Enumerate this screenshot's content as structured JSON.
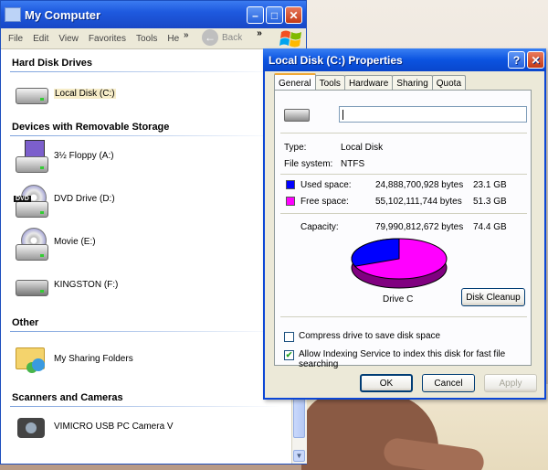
{
  "my_computer": {
    "title": "My Computer",
    "menu": [
      "File",
      "Edit",
      "View",
      "Favorites",
      "Tools",
      "He"
    ],
    "menu_more": "»",
    "back_label": "Back",
    "toolbar_more": "»",
    "groups": [
      {
        "heading": "Hard Disk Drives",
        "items": [
          {
            "label": "Local Disk (C:)",
            "icon": "hard-drive-icon"
          }
        ]
      },
      {
        "heading": "Devices with Removable Storage",
        "items": [
          {
            "label": "3½ Floppy (A:)",
            "icon": "floppy-drive-icon"
          },
          {
            "label": "DVD Drive (D:)",
            "icon": "dvd-drive-icon",
            "tag": "DVD"
          },
          {
            "label": "Movie (E:)",
            "icon": "cd-drive-icon"
          },
          {
            "label": "KINGSTON (F:)",
            "icon": "removable-drive-icon"
          }
        ]
      },
      {
        "heading": "Other",
        "items": [
          {
            "label": "My Sharing Folders",
            "icon": "shared-folder-icon"
          }
        ]
      },
      {
        "heading": "Scanners and Cameras",
        "items": [
          {
            "label": "VIMICRO USB PC Camera V",
            "icon": "camera-icon"
          }
        ]
      }
    ]
  },
  "dialog": {
    "title": "Local Disk (C:) Properties",
    "help": "?",
    "close": "✕",
    "tabs": [
      "General",
      "Tools",
      "Hardware",
      "Sharing",
      "Quota"
    ],
    "name_value": "",
    "type_label": "Type:",
    "type_value": "Local Disk",
    "fs_label": "File system:",
    "fs_value": "NTFS",
    "used_label": "Used space:",
    "used_bytes": "24,888,700,928 bytes",
    "used_gb": "23.1 GB",
    "free_label": "Free space:",
    "free_bytes": "55,102,111,744 bytes",
    "free_gb": "51.3 GB",
    "cap_label": "Capacity:",
    "cap_bytes": "79,990,812,672 bytes",
    "cap_gb": "74.4 GB",
    "drive_label": "Drive C",
    "cleanup_label": "Disk Cleanup",
    "compress_label": "Compress drive to save disk space",
    "compress_checked": false,
    "index_label": "Allow Indexing Service to index this disk for fast file searching",
    "index_checked": true,
    "ok_label": "OK",
    "cancel_label": "Cancel",
    "apply_label": "Apply",
    "colors": {
      "used": "#0000ff",
      "free": "#ff00ff"
    },
    "used_fraction": 0.311
  }
}
